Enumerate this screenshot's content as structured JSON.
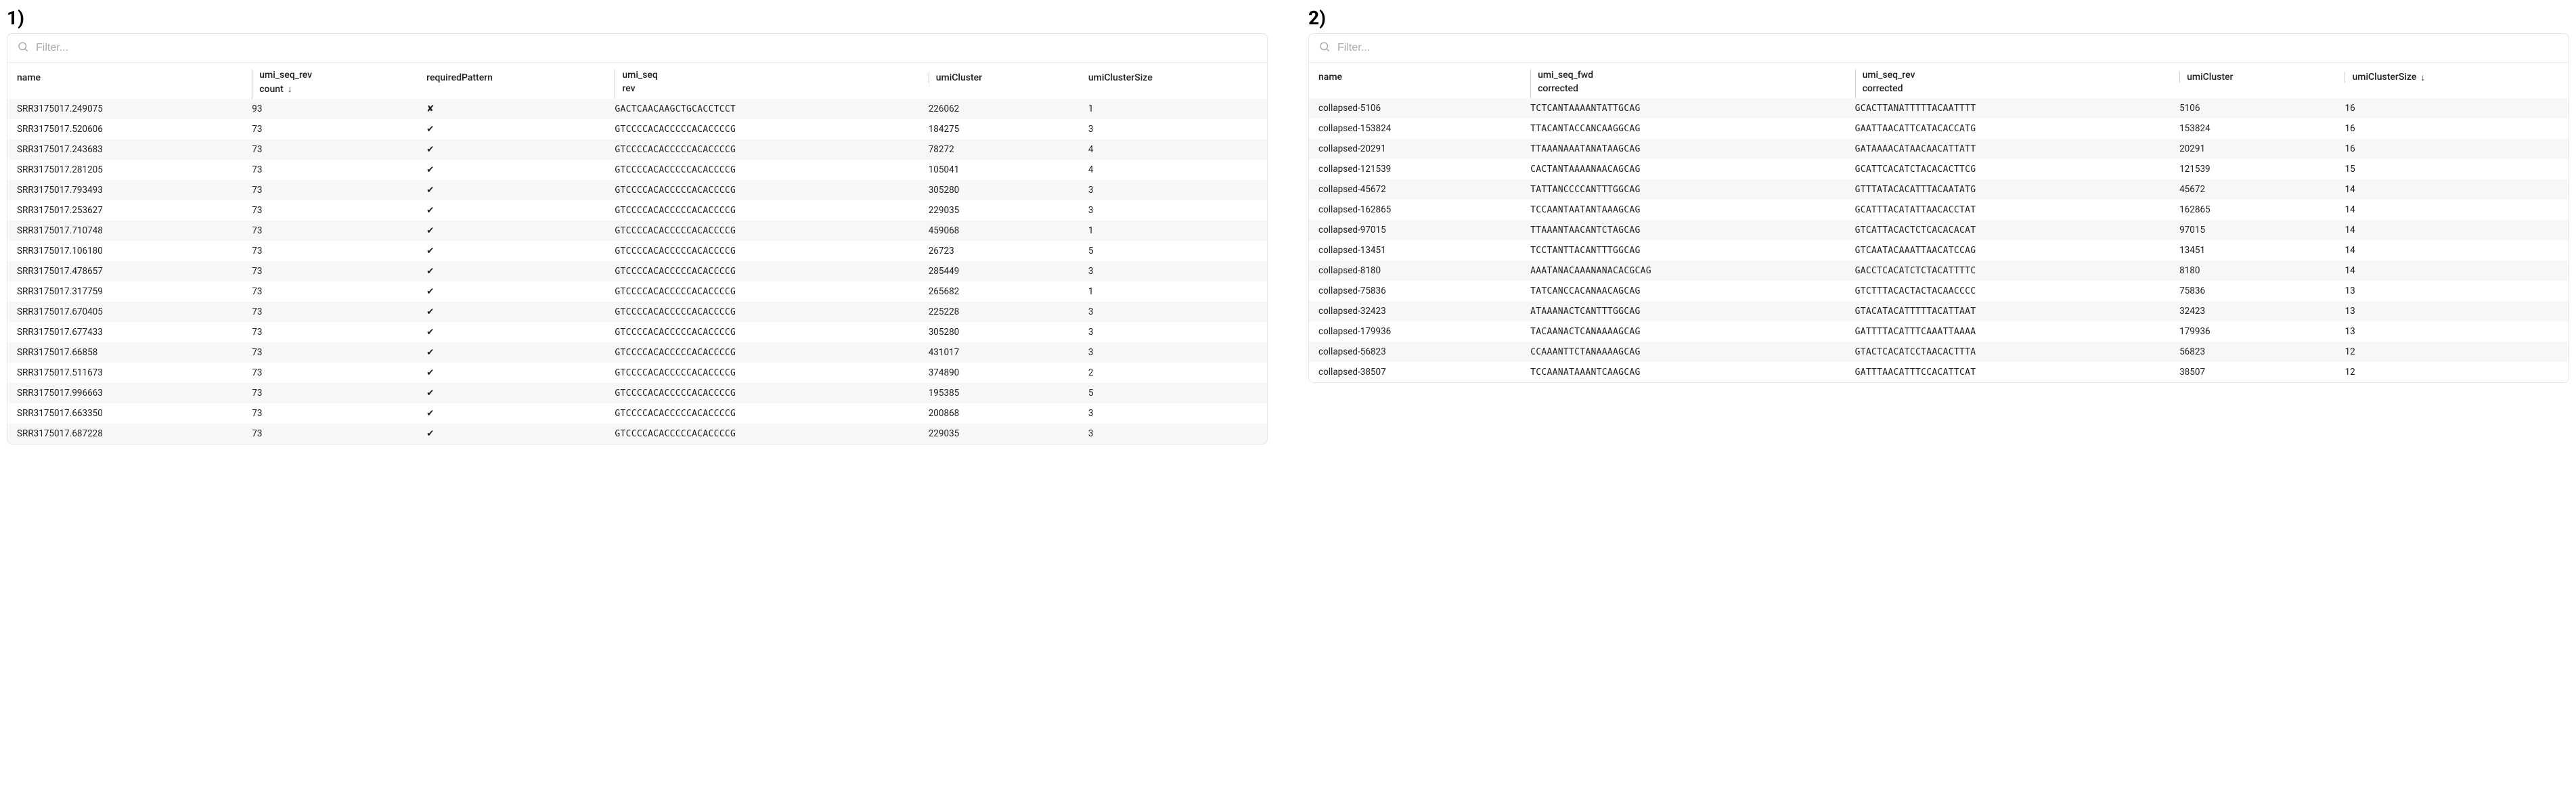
{
  "panels": {
    "left": {
      "label": "1)",
      "filter_placeholder": "Filter...",
      "headers": {
        "name": "name",
        "umi_seq_rev": "umi_seq_rev",
        "count": "count",
        "requiredPattern": "requiredPattern",
        "umi_seq": "umi_seq",
        "rev": "rev",
        "umiCluster": "umiCluster",
        "umiClusterSize": "umiClusterSize"
      },
      "sort_indicator": "↓",
      "rows": [
        {
          "name": "SRR3175017.249075",
          "count": "93",
          "pattern": "✘",
          "rev": "GACTCAACAAGCTGCACCTCCT",
          "cluster": "226062",
          "size": "1"
        },
        {
          "name": "SRR3175017.520606",
          "count": "73",
          "pattern": "✔",
          "rev": "GTCCCCACACCCCCACACCCCG",
          "cluster": "184275",
          "size": "3"
        },
        {
          "name": "SRR3175017.243683",
          "count": "73",
          "pattern": "✔",
          "rev": "GTCCCCACACCCCCACACCCCG",
          "cluster": "78272",
          "size": "4"
        },
        {
          "name": "SRR3175017.281205",
          "count": "73",
          "pattern": "✔",
          "rev": "GTCCCCACACCCCCACACCCCG",
          "cluster": "105041",
          "size": "4"
        },
        {
          "name": "SRR3175017.793493",
          "count": "73",
          "pattern": "✔",
          "rev": "GTCCCCACACCCCCACACCCCG",
          "cluster": "305280",
          "size": "3"
        },
        {
          "name": "SRR3175017.253627",
          "count": "73",
          "pattern": "✔",
          "rev": "GTCCCCACACCCCCACACCCCG",
          "cluster": "229035",
          "size": "3"
        },
        {
          "name": "SRR3175017.710748",
          "count": "73",
          "pattern": "✔",
          "rev": "GTCCCCACACCCCCACACCCCG",
          "cluster": "459068",
          "size": "1"
        },
        {
          "name": "SRR3175017.106180",
          "count": "73",
          "pattern": "✔",
          "rev": "GTCCCCACACCCCCACACCCCG",
          "cluster": "26723",
          "size": "5"
        },
        {
          "name": "SRR3175017.478657",
          "count": "73",
          "pattern": "✔",
          "rev": "GTCCCCACACCCCCACACCCCG",
          "cluster": "285449",
          "size": "3"
        },
        {
          "name": "SRR3175017.317759",
          "count": "73",
          "pattern": "✔",
          "rev": "GTCCCCACACCCCCACACCCCG",
          "cluster": "265682",
          "size": "1"
        },
        {
          "name": "SRR3175017.670405",
          "count": "73",
          "pattern": "✔",
          "rev": "GTCCCCACACCCCCACACCCCG",
          "cluster": "225228",
          "size": "3"
        },
        {
          "name": "SRR3175017.677433",
          "count": "73",
          "pattern": "✔",
          "rev": "GTCCCCACACCCCCACACCCCG",
          "cluster": "305280",
          "size": "3"
        },
        {
          "name": "SRR3175017.66858",
          "count": "73",
          "pattern": "✔",
          "rev": "GTCCCCACACCCCCACACCCCG",
          "cluster": "431017",
          "size": "3"
        },
        {
          "name": "SRR3175017.511673",
          "count": "73",
          "pattern": "✔",
          "rev": "GTCCCCACACCCCCACACCCCG",
          "cluster": "374890",
          "size": "2"
        },
        {
          "name": "SRR3175017.996663",
          "count": "73",
          "pattern": "✔",
          "rev": "GTCCCCACACCCCCACACCCCG",
          "cluster": "195385",
          "size": "5"
        },
        {
          "name": "SRR3175017.663350",
          "count": "73",
          "pattern": "✔",
          "rev": "GTCCCCACACCCCCACACCCCG",
          "cluster": "200868",
          "size": "3"
        },
        {
          "name": "SRR3175017.687228",
          "count": "73",
          "pattern": "✔",
          "rev": "GTCCCCACACCCCCACACCCCG",
          "cluster": "229035",
          "size": "3"
        }
      ]
    },
    "right": {
      "label": "2)",
      "filter_placeholder": "Filter...",
      "headers": {
        "name": "name",
        "umi_seq_fwd": "umi_seq_fwd",
        "corrected": "corrected",
        "umi_seq_rev": "umi_seq_rev",
        "umiCluster": "umiCluster",
        "umiClusterSize": "umiClusterSize"
      },
      "sort_indicator": "↓",
      "rows": [
        {
          "name": "collapsed-5106",
          "fwd": "TCTCANTAAAANTATTGCAG",
          "rev": "GCACTTANATTTTTACAATTTT",
          "cluster": "5106",
          "size": "16"
        },
        {
          "name": "collapsed-153824",
          "fwd": "TTACANTACCANCAAGGCAG",
          "rev": "GAATTAACATTCATACACCATG",
          "cluster": "153824",
          "size": "16"
        },
        {
          "name": "collapsed-20291",
          "fwd": "TTAAANAAATANATAAGCAG",
          "rev": "GATAAAACATAACAACATTATT",
          "cluster": "20291",
          "size": "16"
        },
        {
          "name": "collapsed-121539",
          "fwd": "CACTANTAAAANAACAGCAG",
          "rev": "GCATTCACATCTACACACTTCG",
          "cluster": "121539",
          "size": "15"
        },
        {
          "name": "collapsed-45672",
          "fwd": "TATTANCCCCANTTTGGCAG",
          "rev": "GTTTATACACATTTACAATATG",
          "cluster": "45672",
          "size": "14"
        },
        {
          "name": "collapsed-162865",
          "fwd": "TCCAANTAATANTAAAGCAG",
          "rev": "GCATTTACATATTAACACCTAT",
          "cluster": "162865",
          "size": "14"
        },
        {
          "name": "collapsed-97015",
          "fwd": "TTAAANTAACANTCTAGCAG",
          "rev": "GTCATTACACTCTCACACACAT",
          "cluster": "97015",
          "size": "14"
        },
        {
          "name": "collapsed-13451",
          "fwd": "TCCTANTTACANTTTGGCAG",
          "rev": "GTCAATACAAATTAACATCCAG",
          "cluster": "13451",
          "size": "14"
        },
        {
          "name": "collapsed-8180",
          "fwd": "AAATANACAAANANACACGCAG",
          "rev": "GACCTCACATCTCTACATTTTC",
          "cluster": "8180",
          "size": "14"
        },
        {
          "name": "collapsed-75836",
          "fwd": "TATCANCCACANAACAGCAG",
          "rev": "GTCTTTACACTACTACAACCCC",
          "cluster": "75836",
          "size": "13"
        },
        {
          "name": "collapsed-32423",
          "fwd": "ATAAANACTCANTTTGGCAG",
          "rev": "GTACATACATTTTTACATTAAT",
          "cluster": "32423",
          "size": "13"
        },
        {
          "name": "collapsed-179936",
          "fwd": "TACAANACTCANAAAAGCAG",
          "rev": "GATTTTACATTTCAAATTAAAA",
          "cluster": "179936",
          "size": "13"
        },
        {
          "name": "collapsed-56823",
          "fwd": "CCAAANTTCTANAAAAGCAG",
          "rev": "GTACTCACATCCTAACACTTTA",
          "cluster": "56823",
          "size": "12"
        },
        {
          "name": "collapsed-38507",
          "fwd": "TCCAANATAAANTCAAGCAG",
          "rev": "GATTTAACATTTCCACATTCAT",
          "cluster": "38507",
          "size": "12"
        }
      ]
    }
  }
}
